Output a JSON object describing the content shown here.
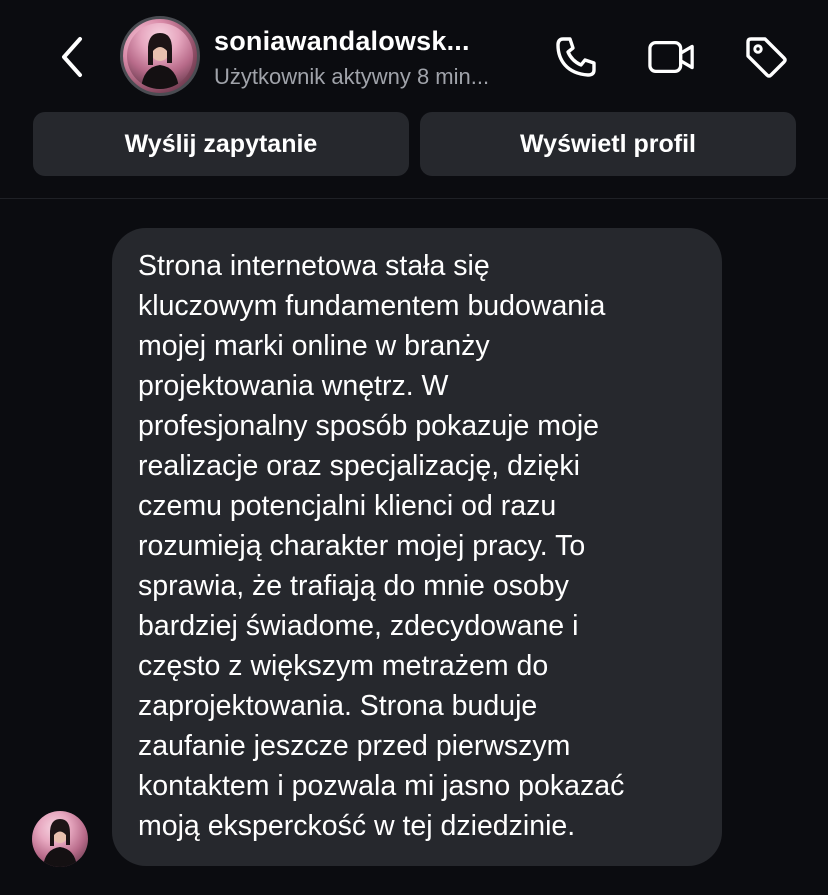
{
  "header": {
    "username": "soniawandalowsk...",
    "status": "Użytkownik aktywny 8 min...",
    "icons": [
      "back-chevron-icon",
      "phone-icon",
      "video-camera-icon",
      "tag-icon"
    ]
  },
  "actions": {
    "request_label": "Wyślij zapytanie",
    "profile_label": "Wyświetl profil"
  },
  "message": {
    "text": "Strona internetowa stała się\nkluczowym fundamentem budowania\nmojej marki online w branży\nprojektowania wnętrz. W\nprofesjonalny sposób pokazuje moje\nrealizacje oraz specjalizację, dzięki\nczemu potencjalni klienci od razu\nrozumieją charakter mojej pracy. To\nsprawia, że trafiają do mnie osoby\nbardziej świadome, zdecydowane i\nczęsto z większym metrażem do\nzaprojektowania. Strona buduje\nzaufanie jeszcze przed pierwszym\nkontaktem i pozwala mi jasno pokazać\nmoją eksperckość w tej dziedzinie."
  },
  "colors": {
    "background": "#0b0c10",
    "surface": "#26282d",
    "text": "#ffffff",
    "muted_text": "#a0a3aa"
  }
}
